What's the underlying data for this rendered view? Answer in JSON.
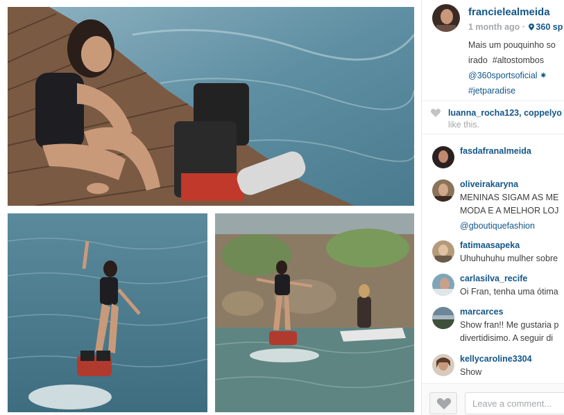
{
  "post": {
    "username": "francielealmeida",
    "time_ago": "1 month ago",
    "meta_separator": " · ",
    "location": "360 sp",
    "caption_lines": [
      {
        "text": "Mais um pouquinho so",
        "is_link": false
      },
      {
        "text": "irado ⁣⁣ #altostombos",
        "is_link": false
      },
      {
        "text": "@360sportsoficial ✷⁣⁣",
        "is_link": true
      },
      {
        "text": "#jetparadise",
        "is_link": false
      }
    ]
  },
  "likes": {
    "names": "luanna_rocha123, coppelyo",
    "tail": "like this."
  },
  "comments": [
    {
      "user": "fasdafranalmeida",
      "lines": [
        "⁣⁣⁣⁣"
      ]
    },
    {
      "user": "oliveirakaryna",
      "lines": [
        "MENINAS SIGAM AS ME",
        "MODA E A MELHOR LOJ",
        "@gboutiquefashion"
      ]
    },
    {
      "user": "fatimaasapeka",
      "lines": [
        "Uhuhuhuhu mulher sobre"
      ]
    },
    {
      "user": "carlasilva_recife",
      "lines": [
        "Oi Fran, tenha uma ótima"
      ]
    },
    {
      "user": "marcarces",
      "lines": [
        "Show fran!! Me gustaria p",
        "divertidisimo. A seguir di"
      ]
    },
    {
      "user": "kellycaroline3304",
      "lines": [
        "Show ⁣⁣⁣⁣"
      ]
    }
  ],
  "footer": {
    "comment_placeholder": "Leave a comment..."
  },
  "icons": {
    "location": "map-pin-icon",
    "likes_heart": "heart-icon",
    "like_button": "heart-outline-icon"
  },
  "colors": {
    "link": "#125688",
    "muted": "#a5a7aa",
    "text": "#3d3d3d"
  }
}
